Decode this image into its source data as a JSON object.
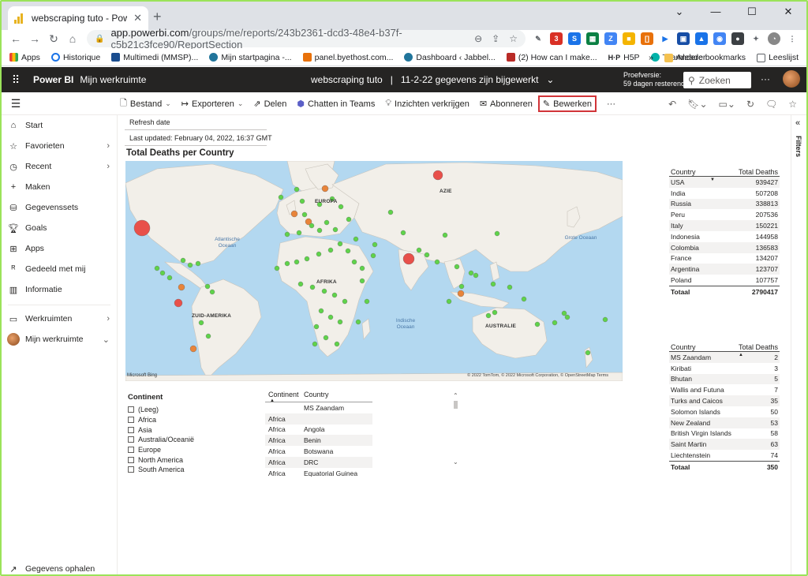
{
  "browser": {
    "tab_title": "webscraping tuto - Power BI",
    "url_host": "app.powerbi.com",
    "url_path": "/groups/me/reports/243b2361-dcd3-48e4-b37f-c5b21c3fce90/ReportSection",
    "window_controls": [
      "⌄",
      "—",
      "☐",
      "✕"
    ]
  },
  "bookmarks": {
    "items": [
      "Apps",
      "Historique",
      "Multimedi (MMSP)...",
      "Mijn startpagina -...",
      "panel.byethost.com...",
      "Dashboard ‹ Jabbel...",
      "(2) How can I make...",
      "H5P",
      "Teamleader"
    ],
    "overflow": "»",
    "others": "Andere bookmarks",
    "reading_list": "Leeslijst"
  },
  "pbi_header": {
    "brand": "Power BI",
    "workspace": "Mijn werkruimte",
    "report_title": "webscraping tuto",
    "separator": "|",
    "update_status": "11-2-22 gegevens zijn bijgewerkt",
    "trial_line1": "Proefversie:",
    "trial_line2": "59 dagen resterend",
    "search_placeholder": "Zoeken",
    "more": "···"
  },
  "toolbar": {
    "file": "Bestand",
    "export": "Exporteren",
    "share": "Delen",
    "teams": "Chatten in Teams",
    "insights": "Inzichten verkrijgen",
    "subscribe": "Abonneren",
    "edit": "Bewerken",
    "more": "···"
  },
  "sidebar": {
    "items": [
      "Start",
      "Favorieten",
      "Recent",
      "Maken",
      "Gegevenssets",
      "Goals",
      "Apps",
      "Gedeeld met mij",
      "Informatie"
    ],
    "workspaces": "Werkruimten",
    "my_workspace": "Mijn werkruimte",
    "get_data": "Gegevens ophalen"
  },
  "report": {
    "refresh_label": "Refresh date",
    "last_updated": "Last updated: February 04, 2022, 16:37 GMT",
    "map_title": "Total Deaths per Country",
    "map_labels": {
      "europe": "EUROPA",
      "asia": "AZIE",
      "africa": "AFRIKA",
      "south_america": "ZUID-AMERIKA",
      "australia": "AUSTRALIE",
      "atlantic": "Atlantische Oceaan",
      "pacific": "Grote Oceaan",
      "indian": "Indische Oceaan"
    },
    "map_credit": "Microsoft Bing",
    "map_copyright": "© 2022 TomTom, © 2022 Microsoft Corporation, © OpenStreetMap  Terms"
  },
  "slicer": {
    "title": "Continent",
    "options": [
      "(Leeg)",
      "Africa",
      "Asia",
      "Australia/Oceanië",
      "Europe",
      "North America",
      "South America"
    ]
  },
  "country_list": {
    "headers": [
      "Continent",
      "Country"
    ],
    "rows": [
      [
        "",
        "MS Zaandam"
      ],
      [
        "Africa",
        ""
      ],
      [
        "Africa",
        "Angola"
      ],
      [
        "Africa",
        "Benin"
      ],
      [
        "Africa",
        "Botswana"
      ],
      [
        "Africa",
        "DRC"
      ],
      [
        "Africa",
        "Equatorial Guinea"
      ]
    ]
  },
  "top_table": {
    "headers": [
      "Country",
      "Total Deaths"
    ],
    "rows": [
      [
        "USA",
        "939427"
      ],
      [
        "India",
        "507208"
      ],
      [
        "Russia",
        "338813"
      ],
      [
        "Peru",
        "207536"
      ],
      [
        "Italy",
        "150221"
      ],
      [
        "Indonesia",
        "144958"
      ],
      [
        "Colombia",
        "136583"
      ],
      [
        "France",
        "134207"
      ],
      [
        "Argentina",
        "123707"
      ],
      [
        "Poland",
        "107757"
      ]
    ],
    "total_label": "Totaal",
    "total_value": "2790417"
  },
  "bottom_table": {
    "headers": [
      "Country",
      "Total Deaths"
    ],
    "rows": [
      [
        "MS Zaandam",
        "2"
      ],
      [
        "Kiribati",
        "3"
      ],
      [
        "Bhutan",
        "5"
      ],
      [
        "Wallis and Futuna",
        "7"
      ],
      [
        "Turks and Caicos",
        "35"
      ],
      [
        "Solomon Islands",
        "50"
      ],
      [
        "New Zealand",
        "53"
      ],
      [
        "British Virgin Islands",
        "58"
      ],
      [
        "Saint Martin",
        "63"
      ],
      [
        "Liechtenstein",
        "74"
      ]
    ],
    "total_label": "Totaal",
    "total_value": "350"
  },
  "filters": {
    "label": "Filters"
  },
  "colors": {
    "high": "#e8504a",
    "mid": "#e8843a",
    "low": "#5fd34a",
    "accent_edit": "#d13438"
  }
}
